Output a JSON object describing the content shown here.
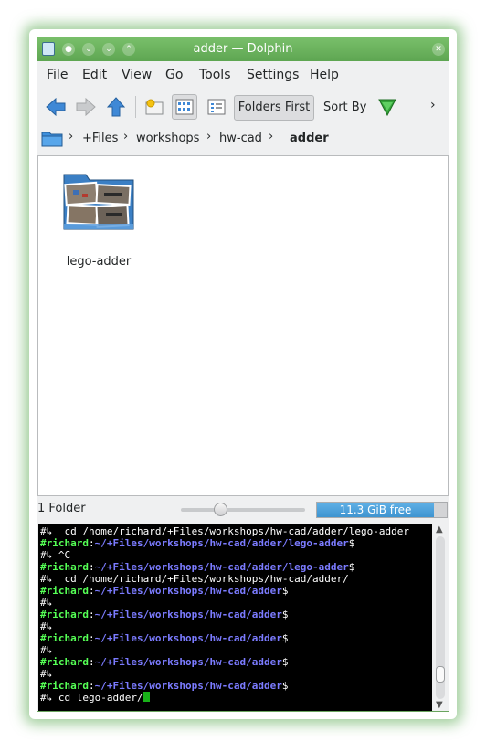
{
  "window": {
    "title": "adder — Dolphin",
    "accent": "#62ab56"
  },
  "menubar": {
    "items": [
      "File",
      "Edit",
      "View",
      "Go",
      "Tools",
      "Settings",
      "Help"
    ]
  },
  "toolbar": {
    "folders_first_label": "Folders First",
    "sort_by_label": "Sort By"
  },
  "breadcrumb": {
    "items": [
      "+Files",
      "workshops",
      "hw-cad",
      "adder"
    ]
  },
  "files": [
    {
      "name": "lego-adder",
      "icon": "folder-icon"
    }
  ],
  "status": {
    "count": "1 Folder",
    "free_space": "11.3 GiB free",
    "used_fraction": 0.9,
    "zoom_fraction": 0.33
  },
  "terminal": {
    "lines": [
      {
        "prompt": false,
        "text": "#↳  cd /home/richard/+Files/workshops/hw-cad/adder/lego-adder"
      },
      {
        "prompt": true,
        "user": "#richard",
        "path": "~/+Files/workshops/hw-cad/adder/lego-adder",
        "symbol": "$"
      },
      {
        "prompt": false,
        "text": "#↳ ^C"
      },
      {
        "prompt": true,
        "user": "#richard",
        "path": "~/+Files/workshops/hw-cad/adder/lego-adder",
        "symbol": "$"
      },
      {
        "prompt": false,
        "text": "#↳  cd /home/richard/+Files/workshops/hw-cad/adder/"
      },
      {
        "prompt": true,
        "user": "#richard",
        "path": "~/+Files/workshops/hw-cad/adder",
        "symbol": "$"
      },
      {
        "prompt": false,
        "text": "#↳"
      },
      {
        "prompt": true,
        "user": "#richard",
        "path": "~/+Files/workshops/hw-cad/adder",
        "symbol": "$"
      },
      {
        "prompt": false,
        "text": "#↳"
      },
      {
        "prompt": true,
        "user": "#richard",
        "path": "~/+Files/workshops/hw-cad/adder",
        "symbol": "$"
      },
      {
        "prompt": false,
        "text": "#↳"
      },
      {
        "prompt": true,
        "user": "#richard",
        "path": "~/+Files/workshops/hw-cad/adder",
        "symbol": "$"
      },
      {
        "prompt": false,
        "text": "#↳"
      },
      {
        "prompt": true,
        "user": "#richard",
        "path": "~/+Files/workshops/hw-cad/adder",
        "symbol": "$"
      },
      {
        "prompt": false,
        "text": "#↳ cd lego-adder/",
        "cursor": true
      }
    ]
  }
}
